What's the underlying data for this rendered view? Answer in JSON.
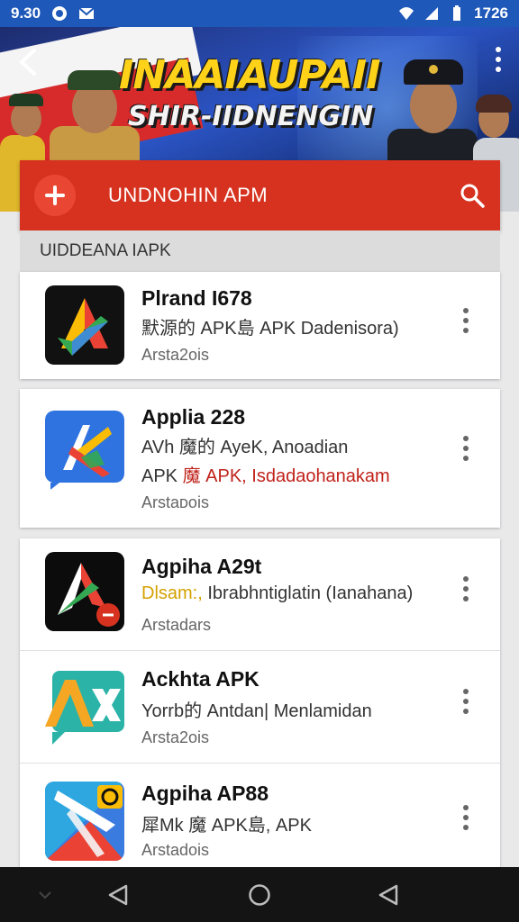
{
  "status_bar": {
    "time_left": "9.30",
    "time_right": "1726"
  },
  "hero": {
    "title_line1": "INAAIAUPAII",
    "title_line2": "SHIR-IIDNENGIN"
  },
  "app_bar": {
    "title": "UNDNOHIN APM",
    "add_icon": "plus-icon",
    "search_icon": "search-icon"
  },
  "section": {
    "label": "UIDDEANA IAPK"
  },
  "apps": [
    {
      "name": "Plrand I678",
      "line1": "默源的  APK島 APK Dadenisora)",
      "meta": "Arsta2ois",
      "icon": "colorful-triangle-icon"
    },
    {
      "name": "Applia 228",
      "line1": "AVh 魔的  AyeK, Anoadian",
      "line2_plain": "APK ",
      "line2_red": "魔  APK,  Isdadaohanakam",
      "meta": "Arstaᴅois",
      "icon": "ax-blue-icon"
    },
    {
      "name": "Agpiha A29t",
      "line1_yellow": "Dlsam:,",
      "line1": " Ibrabhntiglatin (Ianahana)",
      "meta": "Arstadars",
      "icon": "black-triangle-icon"
    },
    {
      "name": "Ackhta APK",
      "line1": "Yorrb的  Antdan| Menlamidan",
      "meta": "Arsta2ois",
      "icon": "ax-yellow-icon"
    },
    {
      "name": "Agpiha AP88",
      "line1": "犀Mk 魔  APK島, APK",
      "meta": "Arstadois",
      "icon": "play-triangle-icon"
    }
  ],
  "nav": {
    "back": "back-triangle-icon",
    "home": "home-circle-icon",
    "recents": "recents-icon"
  }
}
